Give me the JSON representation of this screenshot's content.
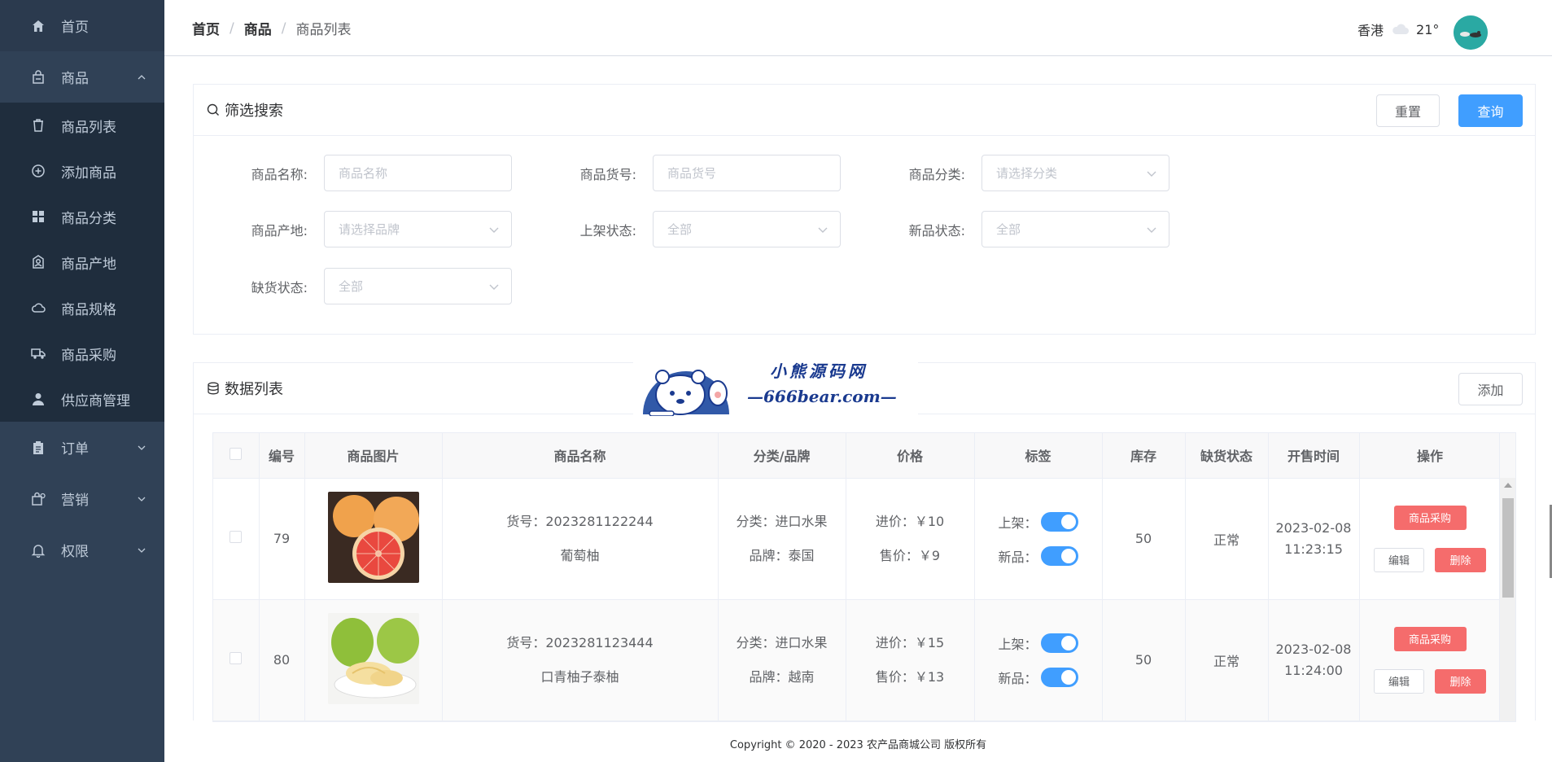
{
  "sidebar": {
    "home": "首页",
    "goods": "商品",
    "sub": [
      {
        "label": "商品列表"
      },
      {
        "label": "添加商品"
      },
      {
        "label": "商品分类"
      },
      {
        "label": "商品产地"
      },
      {
        "label": "商品规格"
      },
      {
        "label": "商品采购"
      },
      {
        "label": "供应商管理"
      }
    ],
    "orders": "订单",
    "marketing": "营销",
    "permissions": "权限"
  },
  "header": {
    "crumb_home": "首页",
    "crumb_goods": "商品",
    "crumb_current": "商品列表",
    "sep": "/",
    "city": "香港",
    "temp": "21°"
  },
  "filter": {
    "title": "筛选搜索",
    "reset": "重置",
    "query": "查询",
    "fields": {
      "name_label": "商品名称:",
      "name_ph": "商品名称",
      "sku_label": "商品货号:",
      "sku_ph": "商品货号",
      "category_label": "商品分类:",
      "category_ph": "请选择分类",
      "origin_label": "商品产地:",
      "origin_ph": "请选择品牌",
      "shelf_label": "上架状态:",
      "shelf_val": "全部",
      "new_label": "新品状态:",
      "new_val": "全部",
      "stock_label": "缺货状态:",
      "stock_val": "全部"
    }
  },
  "list": {
    "title": "数据列表",
    "add": "添加",
    "columns": [
      "编号",
      "商品图片",
      "商品名称",
      "分类/品牌",
      "价格",
      "标签",
      "库存",
      "缺货状态",
      "开售时间",
      "操作"
    ],
    "rows": [
      {
        "id": "79",
        "sku": "货号：2023281122244",
        "name": "葡萄柚",
        "category": "分类：进口水果",
        "brand": "品牌：泰国",
        "cost": "进价：￥10",
        "price": "售价：￥9",
        "tag_shelf": "上架：",
        "tag_new": "新品：",
        "stock": "50",
        "stock_status": "正常",
        "date": "2023-02-08",
        "time": "11:23:15",
        "buy": "商品采购",
        "edit": "编辑",
        "delete": "删除"
      },
      {
        "id": "80",
        "sku": "货号：2023281123444",
        "name": "口青柚子泰柚",
        "category": "分类：进口水果",
        "brand": "品牌：越南",
        "cost": "进价：￥15",
        "price": "售价：￥13",
        "tag_shelf": "上架：",
        "tag_new": "新品：",
        "stock": "50",
        "stock_status": "正常",
        "date": "2023-02-08",
        "time": "11:24:00",
        "buy": "商品采购",
        "edit": "编辑",
        "delete": "删除"
      }
    ]
  },
  "watermark": {
    "line1": "小熊源码网",
    "line2": "—666bear.com—"
  },
  "footer": "Copyright © 2020 - 2023  农产品商城公司 版权所有",
  "colors": {
    "sidebar": "#304156",
    "primary": "#409eff",
    "danger": "#f56c6c"
  }
}
